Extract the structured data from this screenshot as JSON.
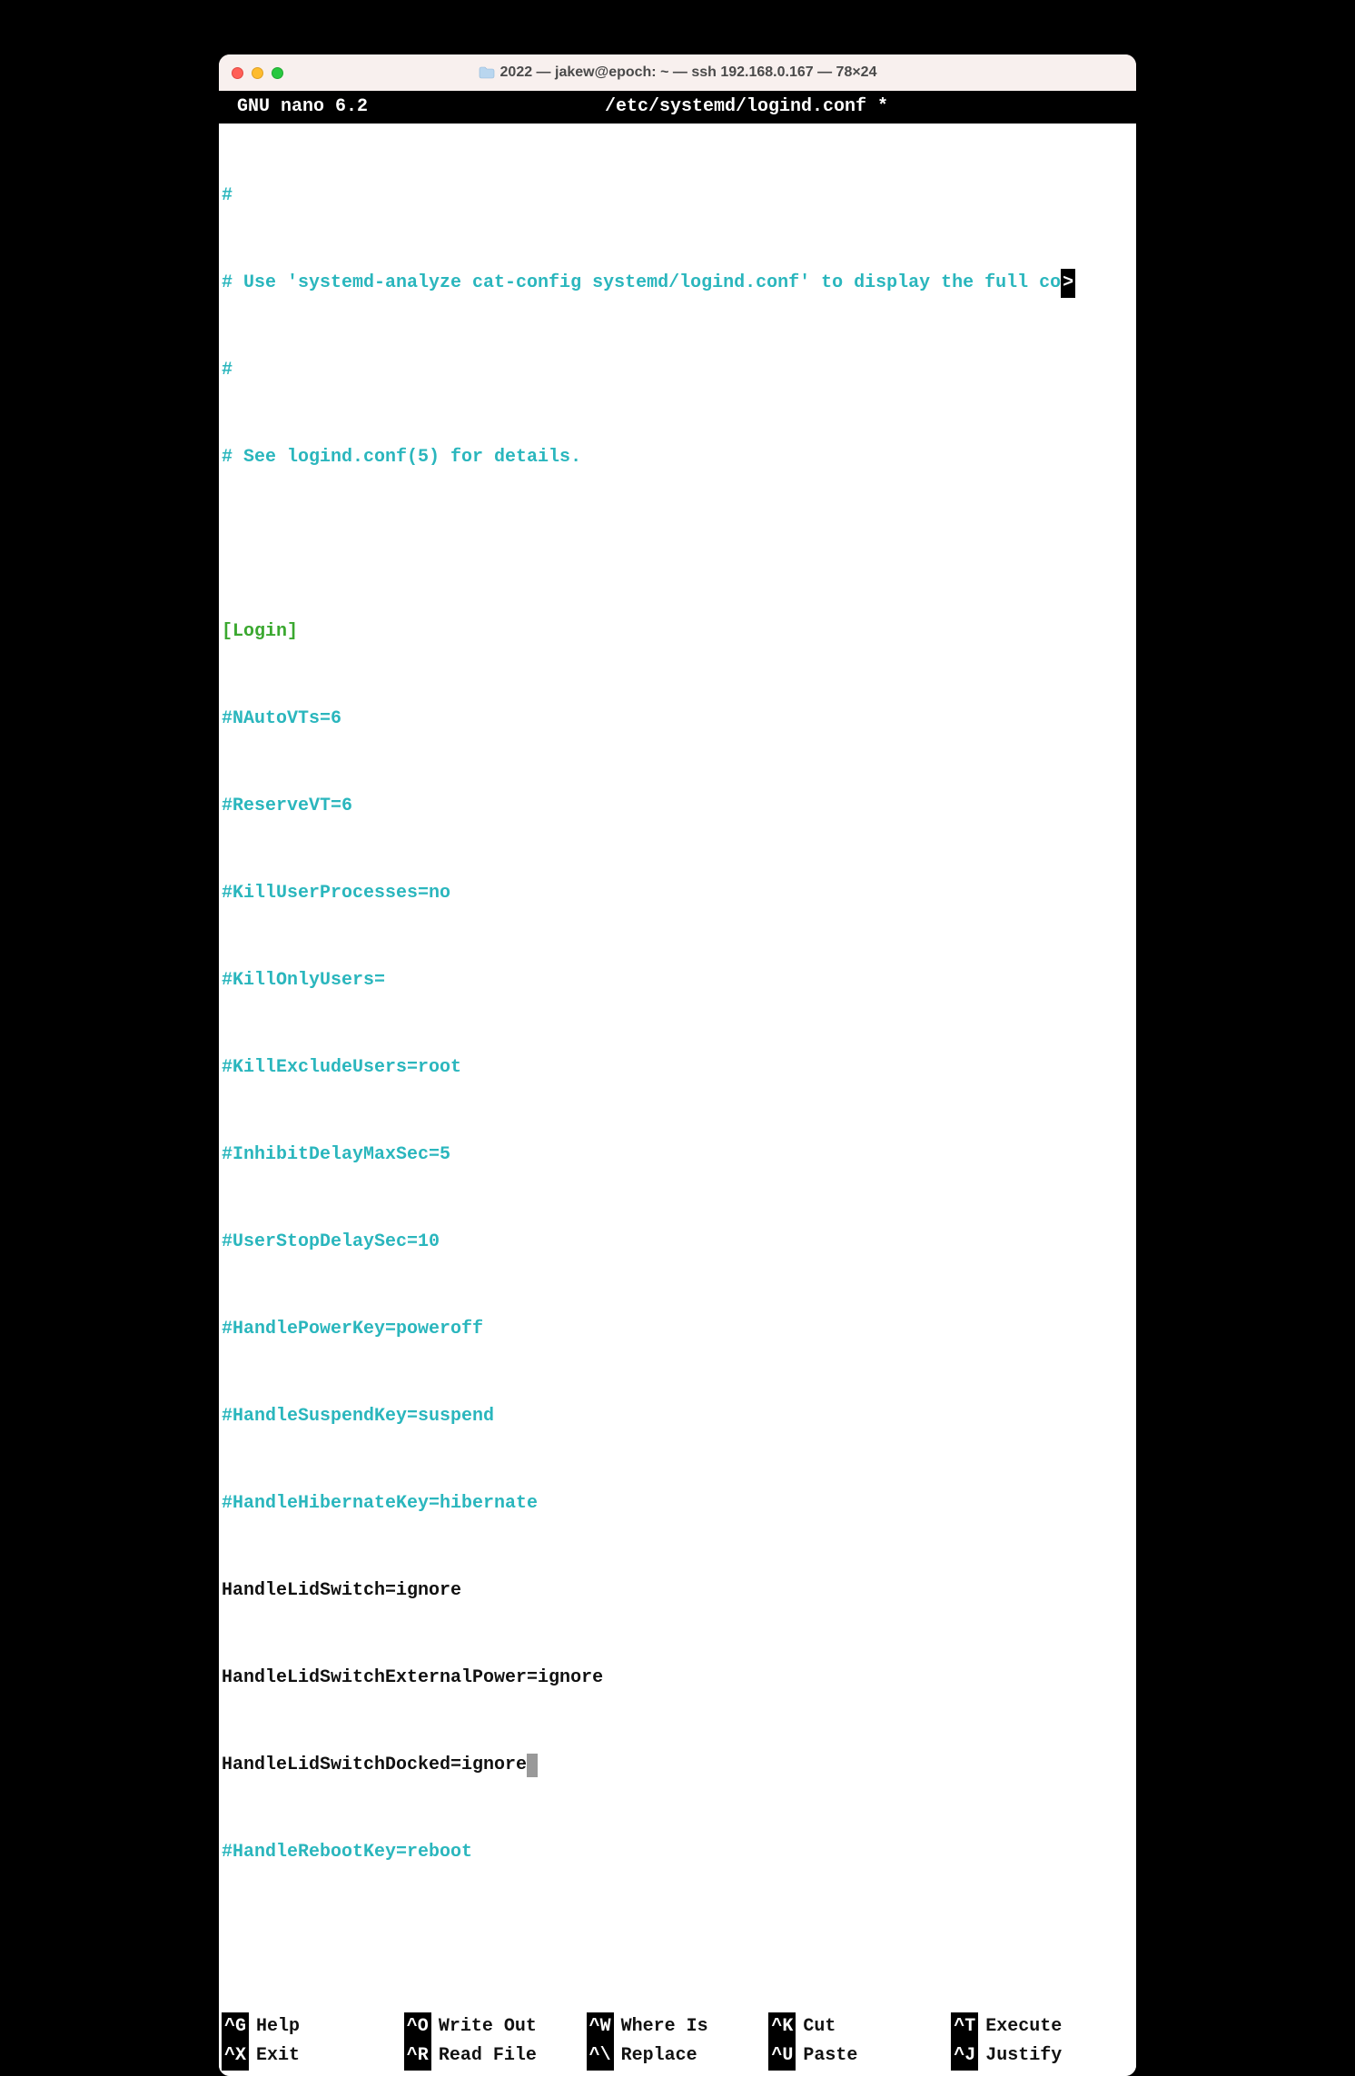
{
  "window": {
    "title": "2022 — jakew@epoch: ~ — ssh 192.168.0.167 — 78×24"
  },
  "nano": {
    "app": "GNU nano 6.2",
    "file": "/etc/systemd/logind.conf *"
  },
  "lines": {
    "l0": "#",
    "l1": "# Use 'systemd-analyze cat-config systemd/logind.conf' to display the full co",
    "l1trunc": ">",
    "l2": "#",
    "l3": "# See logind.conf(5) for details.",
    "l4": "",
    "l5": "[Login]",
    "l6": "#NAutoVTs=6",
    "l7": "#ReserveVT=6",
    "l8": "#KillUserProcesses=no",
    "l9": "#KillOnlyUsers=",
    "l10": "#KillExcludeUsers=root",
    "l11": "#InhibitDelayMaxSec=5",
    "l12": "#UserStopDelaySec=10",
    "l13": "#HandlePowerKey=poweroff",
    "l14": "#HandleSuspendKey=suspend",
    "l15": "#HandleHibernateKey=hibernate",
    "l16": "HandleLidSwitch=ignore",
    "l17": "HandleLidSwitchExternalPower=ignore",
    "l18": "HandleLidSwitchDocked=ignore",
    "l19": "#HandleRebootKey=reboot"
  },
  "shortcuts": {
    "r0c0k": "^G",
    "r0c0l": "Help",
    "r0c1k": "^O",
    "r0c1l": "Write Out",
    "r0c2k": "^W",
    "r0c2l": "Where Is",
    "r0c3k": "^K",
    "r0c3l": "Cut",
    "r0c4k": "^T",
    "r0c4l": "Execute",
    "r1c0k": "^X",
    "r1c0l": "Exit",
    "r1c1k": "^R",
    "r1c1l": "Read File",
    "r1c2k": "^\\",
    "r1c2l": "Replace",
    "r1c3k": "^U",
    "r1c3l": "Paste",
    "r1c4k": "^J",
    "r1c4l": "Justify"
  }
}
